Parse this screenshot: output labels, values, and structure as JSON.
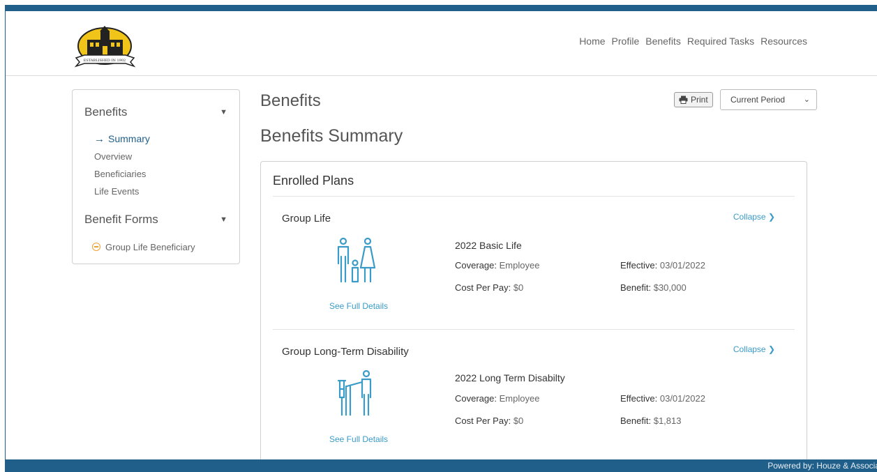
{
  "nav": [
    "Home",
    "Profile",
    "Benefits",
    "Required Tasks",
    "Resources"
  ],
  "logo": {
    "banner_text": "ESTABLISHED IN 1902",
    "colors": {
      "gold": "#f0c419",
      "black": "#222222"
    }
  },
  "sidebar": {
    "benefits_header": "Benefits",
    "items": [
      {
        "label": "Summary",
        "active": true
      },
      {
        "label": "Overview",
        "active": false
      },
      {
        "label": "Beneficiaries",
        "active": false
      },
      {
        "label": "Life Events",
        "active": false
      }
    ],
    "forms_header": "Benefit Forms",
    "forms": [
      {
        "label": "Group Life Beneficiary"
      }
    ]
  },
  "page": {
    "title": "Benefits",
    "subtitle": "Benefits Summary",
    "print_label": "Print",
    "period_selected": "Current Period"
  },
  "panel": {
    "title": "Enrolled Plans",
    "plans": [
      {
        "name": "Group Life",
        "collapse_label": "Collapse",
        "icon": "family-icon",
        "plan_title": "2022 Basic Life",
        "coverage_label": "Coverage:",
        "coverage": "Employee",
        "cost_label": "Cost Per Pay:",
        "cost": "$0",
        "effective_label": "Effective:",
        "effective": "03/01/2022",
        "benefit_label": "Benefit:",
        "benefit": "$30,000",
        "details_label": "See Full Details"
      },
      {
        "name": "Group Long-Term Disability",
        "collapse_label": "Collapse",
        "icon": "disability-assist-icon",
        "plan_title": "2022 Long Term Disabilty",
        "coverage_label": "Coverage:",
        "coverage": "Employee",
        "cost_label": "Cost Per Pay:",
        "cost": "$0",
        "effective_label": "Effective:",
        "effective": "03/01/2022",
        "benefit_label": "Benefit:",
        "benefit": "$1,813",
        "details_label": "See Full Details"
      }
    ]
  },
  "footer": {
    "text": "Powered by: Houze & Associates"
  },
  "colors": {
    "brand": "#1f5f8a",
    "link": "#3a9bc8",
    "icon": "#3a9bc8",
    "warning": "#f0a030"
  }
}
